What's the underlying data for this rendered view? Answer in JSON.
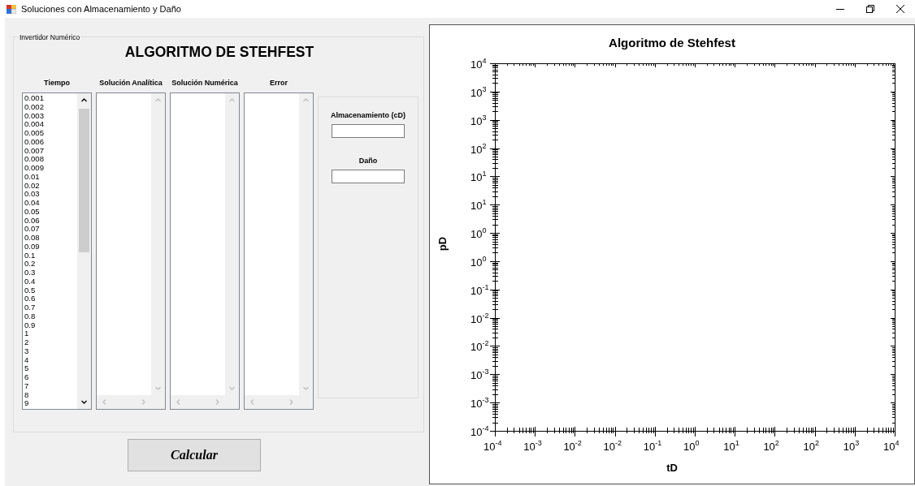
{
  "window": {
    "title": "Soluciones con Almacenamiento y Daño"
  },
  "group": {
    "label": "Invertidor Numérico",
    "heading": "ALGORITMO DE STEHFEST"
  },
  "lists": [
    {
      "header": "Tiempo",
      "scrollable": true,
      "items": [
        "0.001",
        "0.002",
        "0.003",
        "0.004",
        "0.005",
        "0.006",
        "0.007",
        "0.008",
        "0.009",
        "0.01",
        "0.02",
        "0.03",
        "0.04",
        "0.05",
        "0.06",
        "0.07",
        "0.08",
        "0.09",
        "0.1",
        "0.2",
        "0.3",
        "0.4",
        "0.5",
        "0.6",
        "0.7",
        "0.8",
        "0.9",
        "1",
        "2",
        "3",
        "4",
        "5",
        "6",
        "7",
        "8",
        "9"
      ]
    },
    {
      "header": "Solución Analítica",
      "scrollable": false
    },
    {
      "header": "Solución Numérica",
      "scrollable": false
    },
    {
      "header": "Error",
      "scrollable": false
    }
  ],
  "parameters": [
    {
      "label": "Almacenamiento (cD)"
    },
    {
      "label": "Daño"
    }
  ],
  "calculate_button": "Calcular",
  "chart": {
    "title": "Algoritmo de Stehfest",
    "xlabel": "tD",
    "ylabel": "pD",
    "x_tick_labels": [
      "10$^{-4}$",
      "10$^{-3}$",
      "10$^{-2}$",
      "10$^{-2}$",
      "10$^{-1}$",
      "10$^{0}$",
      "10$^{1}$",
      "10$^{2}$",
      "10$^{2}$",
      "10$^{3}$",
      "10$^{4}$"
    ],
    "y_tick_labels": [
      "10$^{4}$",
      "10$^{3}$",
      "10$^{3}$",
      "10$^{2}$",
      "10$^{1}$",
      "10$^{1}$",
      "10$^{0}$",
      "10$^{0}$",
      "10$^{-1}$",
      "10$^{-2}$",
      "10$^{-2}$",
      "10$^{-3}$",
      "10$^{-3}$",
      "10$^{-4}$"
    ]
  }
}
